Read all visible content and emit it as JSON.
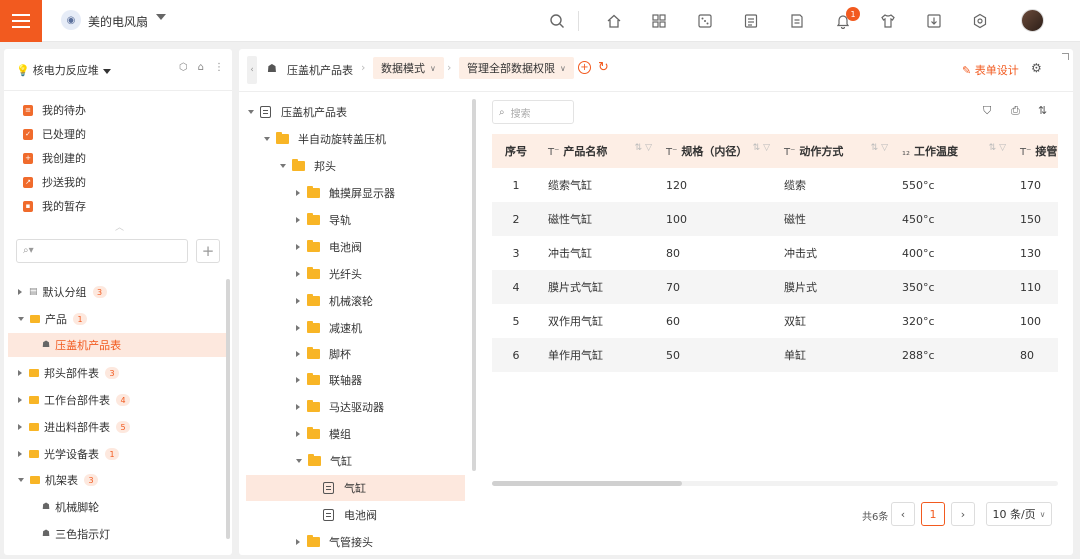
{
  "topbar": {
    "app_title": "美的电风扇",
    "notification_count": "1",
    "icons": [
      "search-icon",
      "home-icon",
      "apps-icon",
      "dice-icon",
      "list-icon",
      "report-icon",
      "bell-icon",
      "shirt-icon",
      "download-icon",
      "settings-icon"
    ]
  },
  "sidebar": {
    "org_name": "核电力反应堆",
    "quick_links": [
      {
        "label": "我的待办"
      },
      {
        "label": "已处理的"
      },
      {
        "label": "我创建的"
      },
      {
        "label": "抄送我的"
      },
      {
        "label": "我的暂存"
      }
    ],
    "tree": [
      {
        "label": "默认分组",
        "badge": "3"
      },
      {
        "label": "产品",
        "badge": "1"
      },
      {
        "label": "压盖机产品表"
      },
      {
        "label": "邦头部件表",
        "badge": "3"
      },
      {
        "label": "工作台部件表",
        "badge": "4"
      },
      {
        "label": "进出料部件表",
        "badge": "5"
      },
      {
        "label": "光学设备表",
        "badge": "1"
      },
      {
        "label": "机架表",
        "badge": "3"
      },
      {
        "label": "机械脚轮"
      },
      {
        "label": "三色指示灯"
      }
    ]
  },
  "toolbar": {
    "crumb_table": "压盖机产品表",
    "mode_label": "数据模式",
    "permission_label": "管理全部数据权限",
    "form_design_label": "表单设计"
  },
  "tree2": [
    {
      "label": "压盖机产品表"
    },
    {
      "label": "半自动旋转盖压机"
    },
    {
      "label": "邦头"
    },
    {
      "label": "触摸屏显示器"
    },
    {
      "label": "导轨"
    },
    {
      "label": "电池阀"
    },
    {
      "label": "光纤头"
    },
    {
      "label": "机械滚轮"
    },
    {
      "label": "减速机"
    },
    {
      "label": "脚杯"
    },
    {
      "label": "联轴器"
    },
    {
      "label": "马达驱动器"
    },
    {
      "label": "模组"
    },
    {
      "label": "气缸"
    },
    {
      "label": "气缸"
    },
    {
      "label": "电池阀"
    },
    {
      "label": "气管接头"
    }
  ],
  "grid": {
    "search_placeholder": "搜索",
    "columns": [
      "序号",
      "产品名称",
      "规格（内径）",
      "动作方式",
      "工作温度",
      "接管"
    ],
    "rows": [
      [
        "1",
        "缆索气缸",
        "120",
        "缆索",
        "550°c",
        "170"
      ],
      [
        "2",
        "磁性气缸",
        "100",
        "磁性",
        "450°c",
        "150"
      ],
      [
        "3",
        "冲击气缸",
        "80",
        "冲击式",
        "400°c",
        "130"
      ],
      [
        "4",
        "膜片式气缸",
        "70",
        "膜片式",
        "350°c",
        "110"
      ],
      [
        "5",
        "双作用气缸",
        "60",
        "双缸",
        "320°c",
        "100"
      ],
      [
        "6",
        "单作用气缸",
        "50",
        "单缸",
        "288°c",
        "80"
      ]
    ]
  },
  "pagination": {
    "total_text": "共6条",
    "current_page": "1",
    "page_size_label": "10 条/页"
  },
  "colors": {
    "accent": "#f25a1f",
    "header_bg": "#fdeee5",
    "active_bg": "#fde8de",
    "folder": "#f8b526"
  }
}
